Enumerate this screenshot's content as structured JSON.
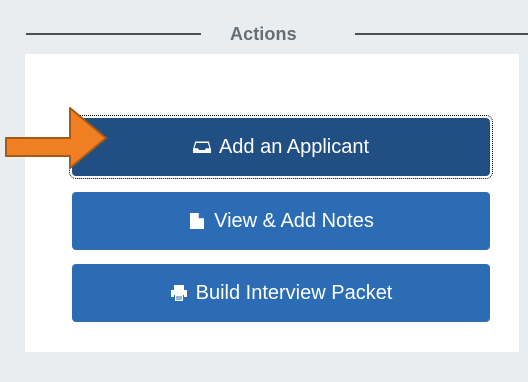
{
  "section": {
    "title": "Actions"
  },
  "buttons": {
    "add_applicant": "Add an Applicant",
    "view_notes": "View & Add Notes",
    "build_packet": "Build Interview Packet"
  },
  "icons": {
    "add_applicant": "inbox-icon",
    "view_notes": "document-icon",
    "build_packet": "printer-icon",
    "pointer": "arrow-pointer-icon"
  },
  "colors": {
    "background": "#e9edf0",
    "panel": "#ffffff",
    "button_primary": "#214f84",
    "button": "#2b6cb5",
    "pointer": "#ef7f22",
    "title": "#666e75"
  }
}
